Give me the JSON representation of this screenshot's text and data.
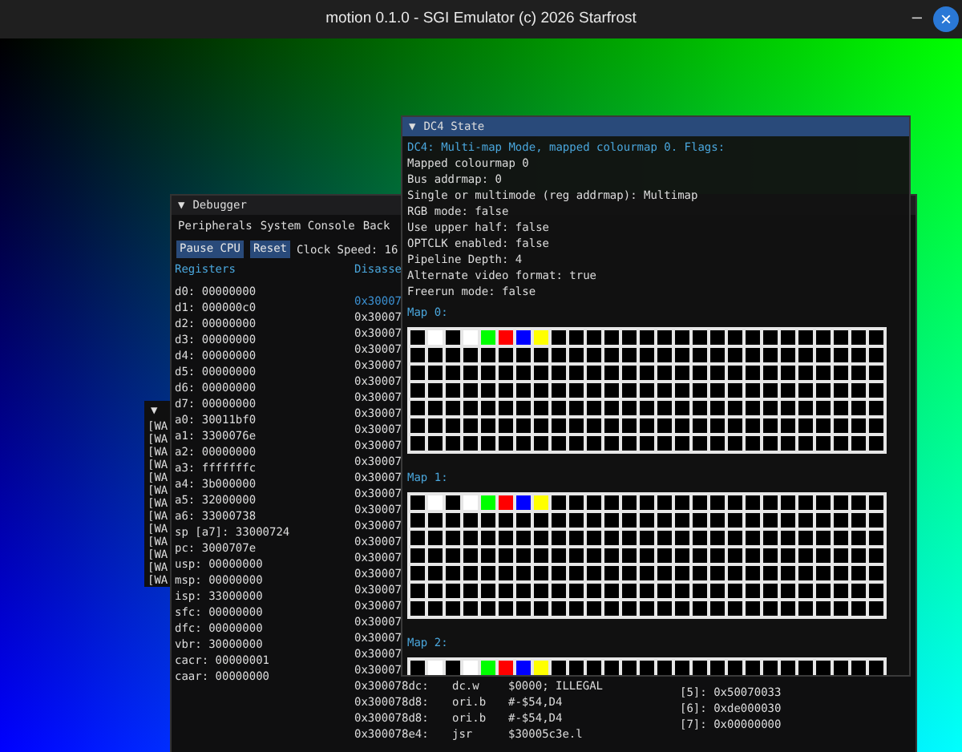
{
  "window": {
    "title": "motion 0.1.0 - SGI Emulator (c) 2026 Starfrost",
    "minimize": "–",
    "close": "×"
  },
  "log_window": {
    "arrow": "▼",
    "lines": [
      "[WA",
      "[WA",
      "[WA",
      "[WA",
      "[WA",
      "[WA",
      "[WA",
      "[WA",
      "[WA",
      "[WA",
      "[WA",
      "[WA",
      "[WA"
    ]
  },
  "debugger": {
    "arrow": "▼",
    "title": "Debugger",
    "menu": [
      "Peripherals",
      "System Console",
      "Back"
    ],
    "buttons": [
      "Pause CPU",
      "Reset"
    ],
    "clock_speed": "Clock Speed: 16",
    "registers_heading": "Registers",
    "registers": [
      "d0: 00000000",
      "d1: 000000c0",
      "d2: 00000000",
      "d3: 00000000",
      "d4: 00000000",
      "d5: 00000000",
      "d6: 00000000",
      "d7: 00000000",
      "a0: 30011bf0",
      "a1: 3300076e",
      "a2: 00000000",
      "a3: fffffffc",
      "a4: 3b000000",
      "a5: 32000000",
      "a6: 33000738",
      "sp [a7]: 33000724",
      "pc: 3000707e",
      "usp: 00000000",
      "msp: 00000000",
      "isp: 33000000",
      "sfc: 00000000",
      "dfc: 00000000",
      "vbr: 30000000",
      "cacr: 00000001",
      "caar: 00000000"
    ],
    "disassembly_heading": "Disasse",
    "disassembly": [
      {
        "address": "0x30007",
        "selected": true
      },
      {
        "address": "0x30007",
        "selected": false
      },
      {
        "address": "0x30007",
        "selected": false
      },
      {
        "address": "0x30007",
        "selected": false
      },
      {
        "address": "0x30007",
        "selected": false
      },
      {
        "address": "0x30007",
        "selected": false
      },
      {
        "address": "0x30007",
        "selected": false
      },
      {
        "address": "0x30007",
        "selected": false
      },
      {
        "address": "0x30007",
        "selected": false
      },
      {
        "address": "0x30007",
        "selected": false
      },
      {
        "address": "0x30007",
        "selected": false
      },
      {
        "address": "0x30007",
        "selected": false
      },
      {
        "address": "0x30007",
        "selected": false
      },
      {
        "address": "0x30007",
        "selected": false
      },
      {
        "address": "0x30007",
        "selected": false
      },
      {
        "address": "0x30007",
        "selected": false
      },
      {
        "address": "0x30007",
        "selected": false
      },
      {
        "address": "0x30007",
        "selected": false
      },
      {
        "address": "0x30007",
        "selected": false
      },
      {
        "address": "0x30007",
        "selected": false
      },
      {
        "address": "0x30007",
        "selected": false
      },
      {
        "address": "0x30007",
        "selected": false
      },
      {
        "address": "0x30007",
        "selected": false
      },
      {
        "address": "0x30007",
        "selected": false
      },
      {
        "address": "0x300078dc:",
        "mnemonic": "dc.w",
        "operands": "$0000; ILLEGAL",
        "selected": false
      },
      {
        "address": "0x300078d8:",
        "mnemonic": "ori.b",
        "operands": "#-$54,D4",
        "selected": false
      },
      {
        "address": "0x300078d8:",
        "mnemonic": "ori.b",
        "operands": "#-$54,D4",
        "selected": false
      },
      {
        "address": "0x300078e4:",
        "mnemonic": "jsr",
        "operands": "$30005c3e.l",
        "selected": false
      }
    ],
    "stack": [
      "[5]: 0x50070033",
      "[6]: 0xde000030",
      "[7]: 0x00000000"
    ]
  },
  "dc4_window": {
    "arrow": "▼",
    "title": "DC4 State",
    "header": "DC4: Multi-map Mode, mapped colourmap 0. Flags:",
    "lines": [
      "Mapped colourmap 0",
      "Bus addrmap: 0",
      "Single or multimode (reg addrmap): Multimap",
      "RGB mode: false",
      "Use upper half: false",
      "OPTCLK enabled: false",
      "Pipeline Depth: 4",
      "Alternate video format: true",
      "Freerun mode: false"
    ],
    "maps": [
      {
        "label": "Map 0:",
        "cells": [
          {
            "kind": "empty"
          },
          {
            "kind": "swatch",
            "color": "#ffffff"
          },
          {
            "kind": "empty"
          },
          {
            "kind": "swatch",
            "color": "#ffffff"
          },
          {
            "kind": "swatch",
            "color": "#00ff00"
          },
          {
            "kind": "swatch",
            "color": "#ff0000"
          },
          {
            "kind": "swatch",
            "color": "#0000ff"
          },
          {
            "kind": "swatch",
            "color": "#ffff00"
          }
        ]
      },
      {
        "label": "Map 1:",
        "cells": [
          {
            "kind": "empty"
          },
          {
            "kind": "swatch",
            "color": "#ffffff"
          },
          {
            "kind": "empty"
          },
          {
            "kind": "swatch",
            "color": "#ffffff"
          },
          {
            "kind": "swatch",
            "color": "#00ff00"
          },
          {
            "kind": "swatch",
            "color": "#ff0000"
          },
          {
            "kind": "swatch",
            "color": "#0000ff"
          },
          {
            "kind": "swatch",
            "color": "#ffff00"
          }
        ]
      },
      {
        "label": "Map 2:",
        "cells": [
          {
            "kind": "empty"
          },
          {
            "kind": "swatch",
            "color": "#ffffff"
          },
          {
            "kind": "empty"
          },
          {
            "kind": "swatch",
            "color": "#ffffff"
          },
          {
            "kind": "swatch",
            "color": "#00ff00"
          },
          {
            "kind": "swatch",
            "color": "#ff0000"
          },
          {
            "kind": "swatch",
            "color": "#0000ff"
          },
          {
            "kind": "swatch",
            "color": "#ffff00"
          }
        ]
      }
    ]
  }
}
